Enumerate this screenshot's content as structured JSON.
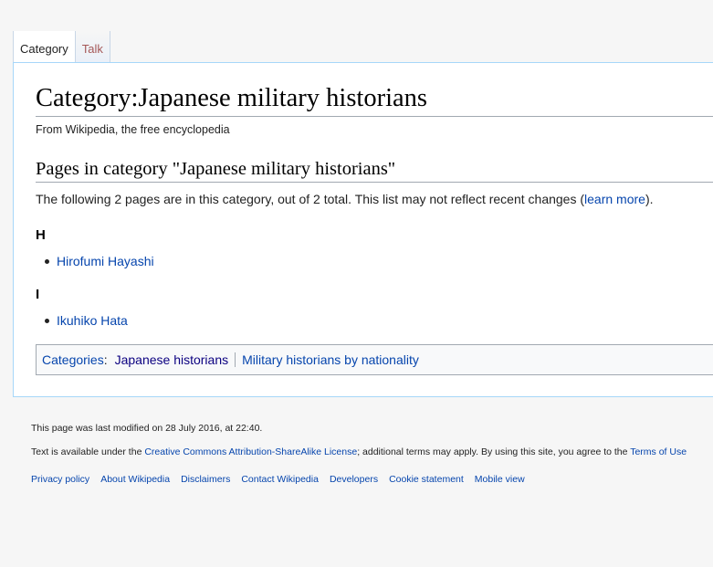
{
  "tabs": {
    "category": "Category",
    "talk": "Talk"
  },
  "page": {
    "title": "Category:Japanese military historians",
    "subtitle": "From Wikipedia, the free encyclopedia"
  },
  "section": {
    "heading": "Pages in category \"Japanese military historians\"",
    "intro_text": "The following 2 pages are in this category, out of 2 total. This list may not reflect recent changes (",
    "intro_link": "learn more",
    "intro_end": ")."
  },
  "groups": [
    {
      "letter": "H",
      "items": [
        "Hirofumi Hayashi"
      ]
    },
    {
      "letter": "I",
      "items": [
        "Ikuhiko Hata"
      ]
    }
  ],
  "categories": {
    "label": "Categories",
    "colon": ":",
    "items": [
      "Japanese historians",
      "Military historians by nationality"
    ]
  },
  "footer": {
    "last_modified": "This page was last modified on 28 July 2016, at 22:40.",
    "license_pre": "Text is available under the ",
    "license_link": "Creative Commons Attribution-ShareAlike License",
    "license_post": "; additional terms may apply. By using this site, you agree to the ",
    "terms_link": "Terms of Use",
    "places": [
      "Privacy policy",
      "About Wikipedia",
      "Disclaimers",
      "Contact Wikipedia",
      "Developers",
      "Cookie statement",
      "Mobile view"
    ]
  },
  "colors": {
    "link": "#0645ad",
    "visited_link": "#0b0080",
    "talk_tab": "#a55858",
    "border": "#a7d7f9"
  }
}
